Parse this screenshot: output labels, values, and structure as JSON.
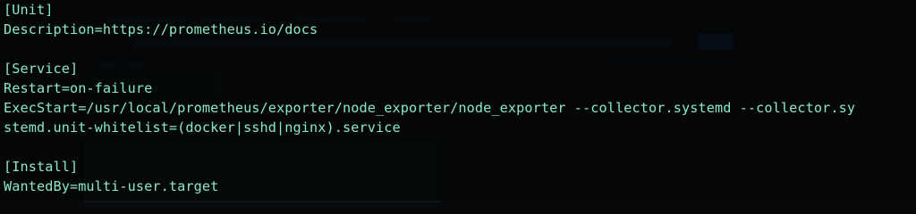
{
  "terminal": {
    "colors": {
      "background": "#07090a",
      "text": "#8ce7c9"
    },
    "lines": [
      "[Unit]",
      "Description=https://prometheus.io/docs",
      "",
      "[Service]",
      "Restart=on-failure",
      "ExecStart=/usr/local/prometheus/exporter/node_exporter/node_exporter --collector.systemd --collector.sy",
      "stemd.unit-whitelist=(docker|sshd|nginx).service",
      "",
      "[Install]",
      "WantedBy=multi-user.target"
    ]
  }
}
